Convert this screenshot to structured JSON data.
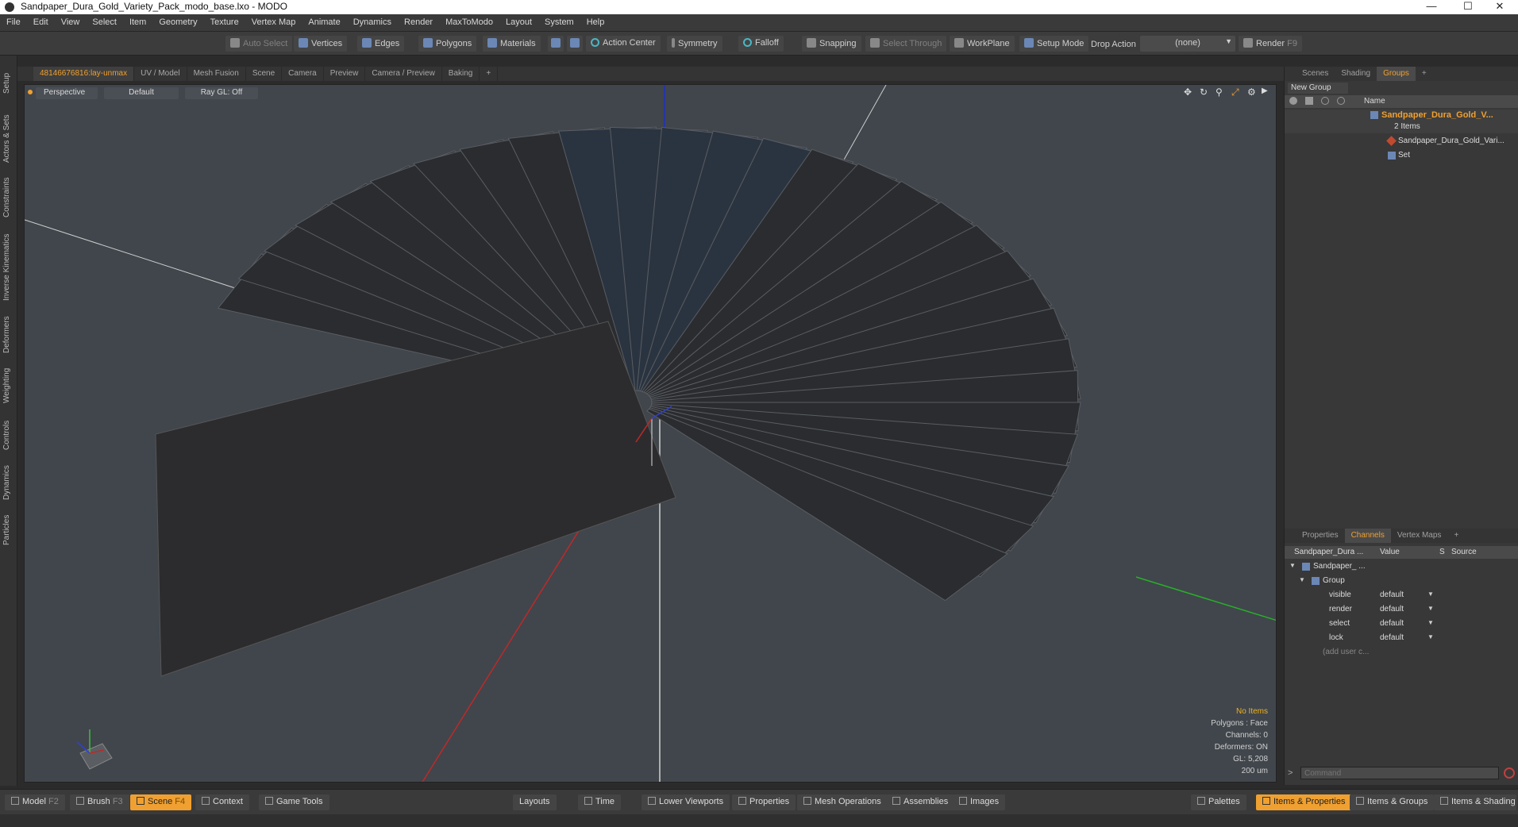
{
  "window": {
    "title": "Sandpaper_Dura_Gold_Variety_Pack_modo_base.lxo - MODO"
  },
  "menu": [
    "File",
    "Edit",
    "View",
    "Select",
    "Item",
    "Geometry",
    "Texture",
    "Vertex Map",
    "Animate",
    "Dynamics",
    "Render",
    "MaxToModo",
    "Layout",
    "System",
    "Help"
  ],
  "toolbar": {
    "auto_select": "Auto Select",
    "vertices": "Vertices",
    "edges": "Edges",
    "polygons": "Polygons",
    "materials": "Materials",
    "action_center": "Action Center",
    "symmetry": "Symmetry",
    "falloff": "Falloff",
    "snapping": "Snapping",
    "select_through": "Select Through",
    "workplane": "WorkPlane",
    "setup_mode": "Setup Mode",
    "drop_action": "Drop Action",
    "drop_value": "(none)",
    "render": "Render",
    "render_key": "F9"
  },
  "left_tabs": [
    "Setup",
    "Actors & Sets",
    "Constraints",
    "Inverse Kinematics",
    "Deformers",
    "Weighting",
    "Controls",
    "Dynamics",
    "Particles"
  ],
  "viewport_tabs": [
    "48146676816:lay-unmax",
    "UV / Model",
    "Mesh Fusion",
    "Scene",
    "Camera",
    "Preview",
    "Camera / Preview",
    "Baking",
    "+"
  ],
  "viewport": {
    "view": "Perspective",
    "shading": "Default",
    "raygl": "Ray GL: Off",
    "stats": {
      "items": "No Items",
      "polygons": "Polygons : Face",
      "channels": "Channels: 0",
      "deformers": "Deformers: ON",
      "gl": "GL: 5,208",
      "scale": "200 um"
    }
  },
  "right_top_tabs": [
    "Scenes",
    "Shading",
    "Groups",
    "+"
  ],
  "groups": {
    "new_group": "New Group",
    "name_header": "Name",
    "root_name": "Sandpaper_Dura_Gold_V...",
    "root_count": "2 Items",
    "child_mesh": "Sandpaper_Dura_Gold_Vari...",
    "child_set": "Set"
  },
  "right_mid_tabs": [
    "Properties",
    "Channels",
    "Vertex Maps",
    "+"
  ],
  "channels": {
    "col_name": "Sandpaper_Dura ...",
    "col_value": "Value",
    "col_s": "S",
    "col_source": "Source",
    "item": "Sandpaper_ ...",
    "group": "Group",
    "rows": [
      {
        "name": "visible",
        "value": "default"
      },
      {
        "name": "render",
        "value": "default"
      },
      {
        "name": "select",
        "value": "default"
      },
      {
        "name": "lock",
        "value": "default"
      }
    ],
    "add_user": "(add user c..."
  },
  "command": {
    "placeholder": "Command"
  },
  "bottom_left": {
    "model": "Model",
    "model_key": "F2",
    "brush": "Brush",
    "brush_key": "F3",
    "scene": "Scene",
    "scene_key": "F4",
    "context": "Context",
    "game_tools": "Game Tools"
  },
  "bottom_mid": [
    "Layouts",
    "Time",
    "Lower Viewports",
    "Properties",
    "Mesh Operations",
    "Assemblies",
    "Images"
  ],
  "bottom_right": [
    "Palettes",
    "Items & Properties",
    "Items & Groups",
    "Items & Shading"
  ]
}
